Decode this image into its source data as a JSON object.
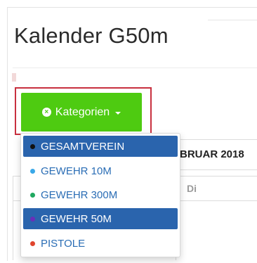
{
  "page": {
    "title": "Kalender G50m"
  },
  "category_button": {
    "label": "Kategorien"
  },
  "calendar": {
    "month_partial": "BRUAR 2018",
    "day_label": "Di"
  },
  "dropdown": {
    "items": [
      {
        "label": "GESAMTVEREIN",
        "dot_color": "#111111",
        "active": true
      },
      {
        "label": "GEWEHR 10M",
        "dot_color": "#3aa8e8",
        "active": false
      },
      {
        "label": "GEWEHR 300M",
        "dot_color": "#20a860",
        "active": false
      },
      {
        "label": "GEWEHR 50M",
        "dot_color": "#6a2fb8",
        "active": true
      },
      {
        "label": "PISTOLE",
        "dot_color": "#e0452d",
        "active": false
      }
    ]
  },
  "colors": {
    "button_bg": "#4ecb11",
    "active_bg": "#2a64ad",
    "highlight_border": "#c8303f"
  }
}
